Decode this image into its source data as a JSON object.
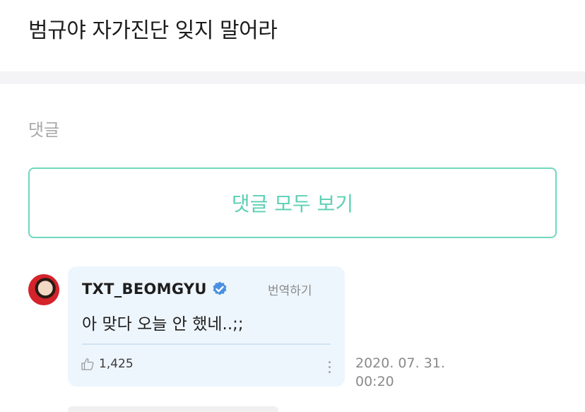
{
  "post": {
    "title": "범규야 자가진단 잊지 말어라"
  },
  "comments_section": {
    "label": "댓글",
    "view_all_label": "댓글 모두 보기"
  },
  "comment": {
    "author": "TXT_BEOMGYU",
    "verified_icon": "verified-badge-icon",
    "translate_label": "번역하기",
    "text": "아 맞다 오늘 안 했네..;;",
    "likes": "1,425",
    "date": "2020. 07. 31.",
    "time": "00:20"
  },
  "colors": {
    "accent": "#5cd0b4",
    "bubble_bg": "#eef6fd",
    "verified": "#4a90e2"
  }
}
